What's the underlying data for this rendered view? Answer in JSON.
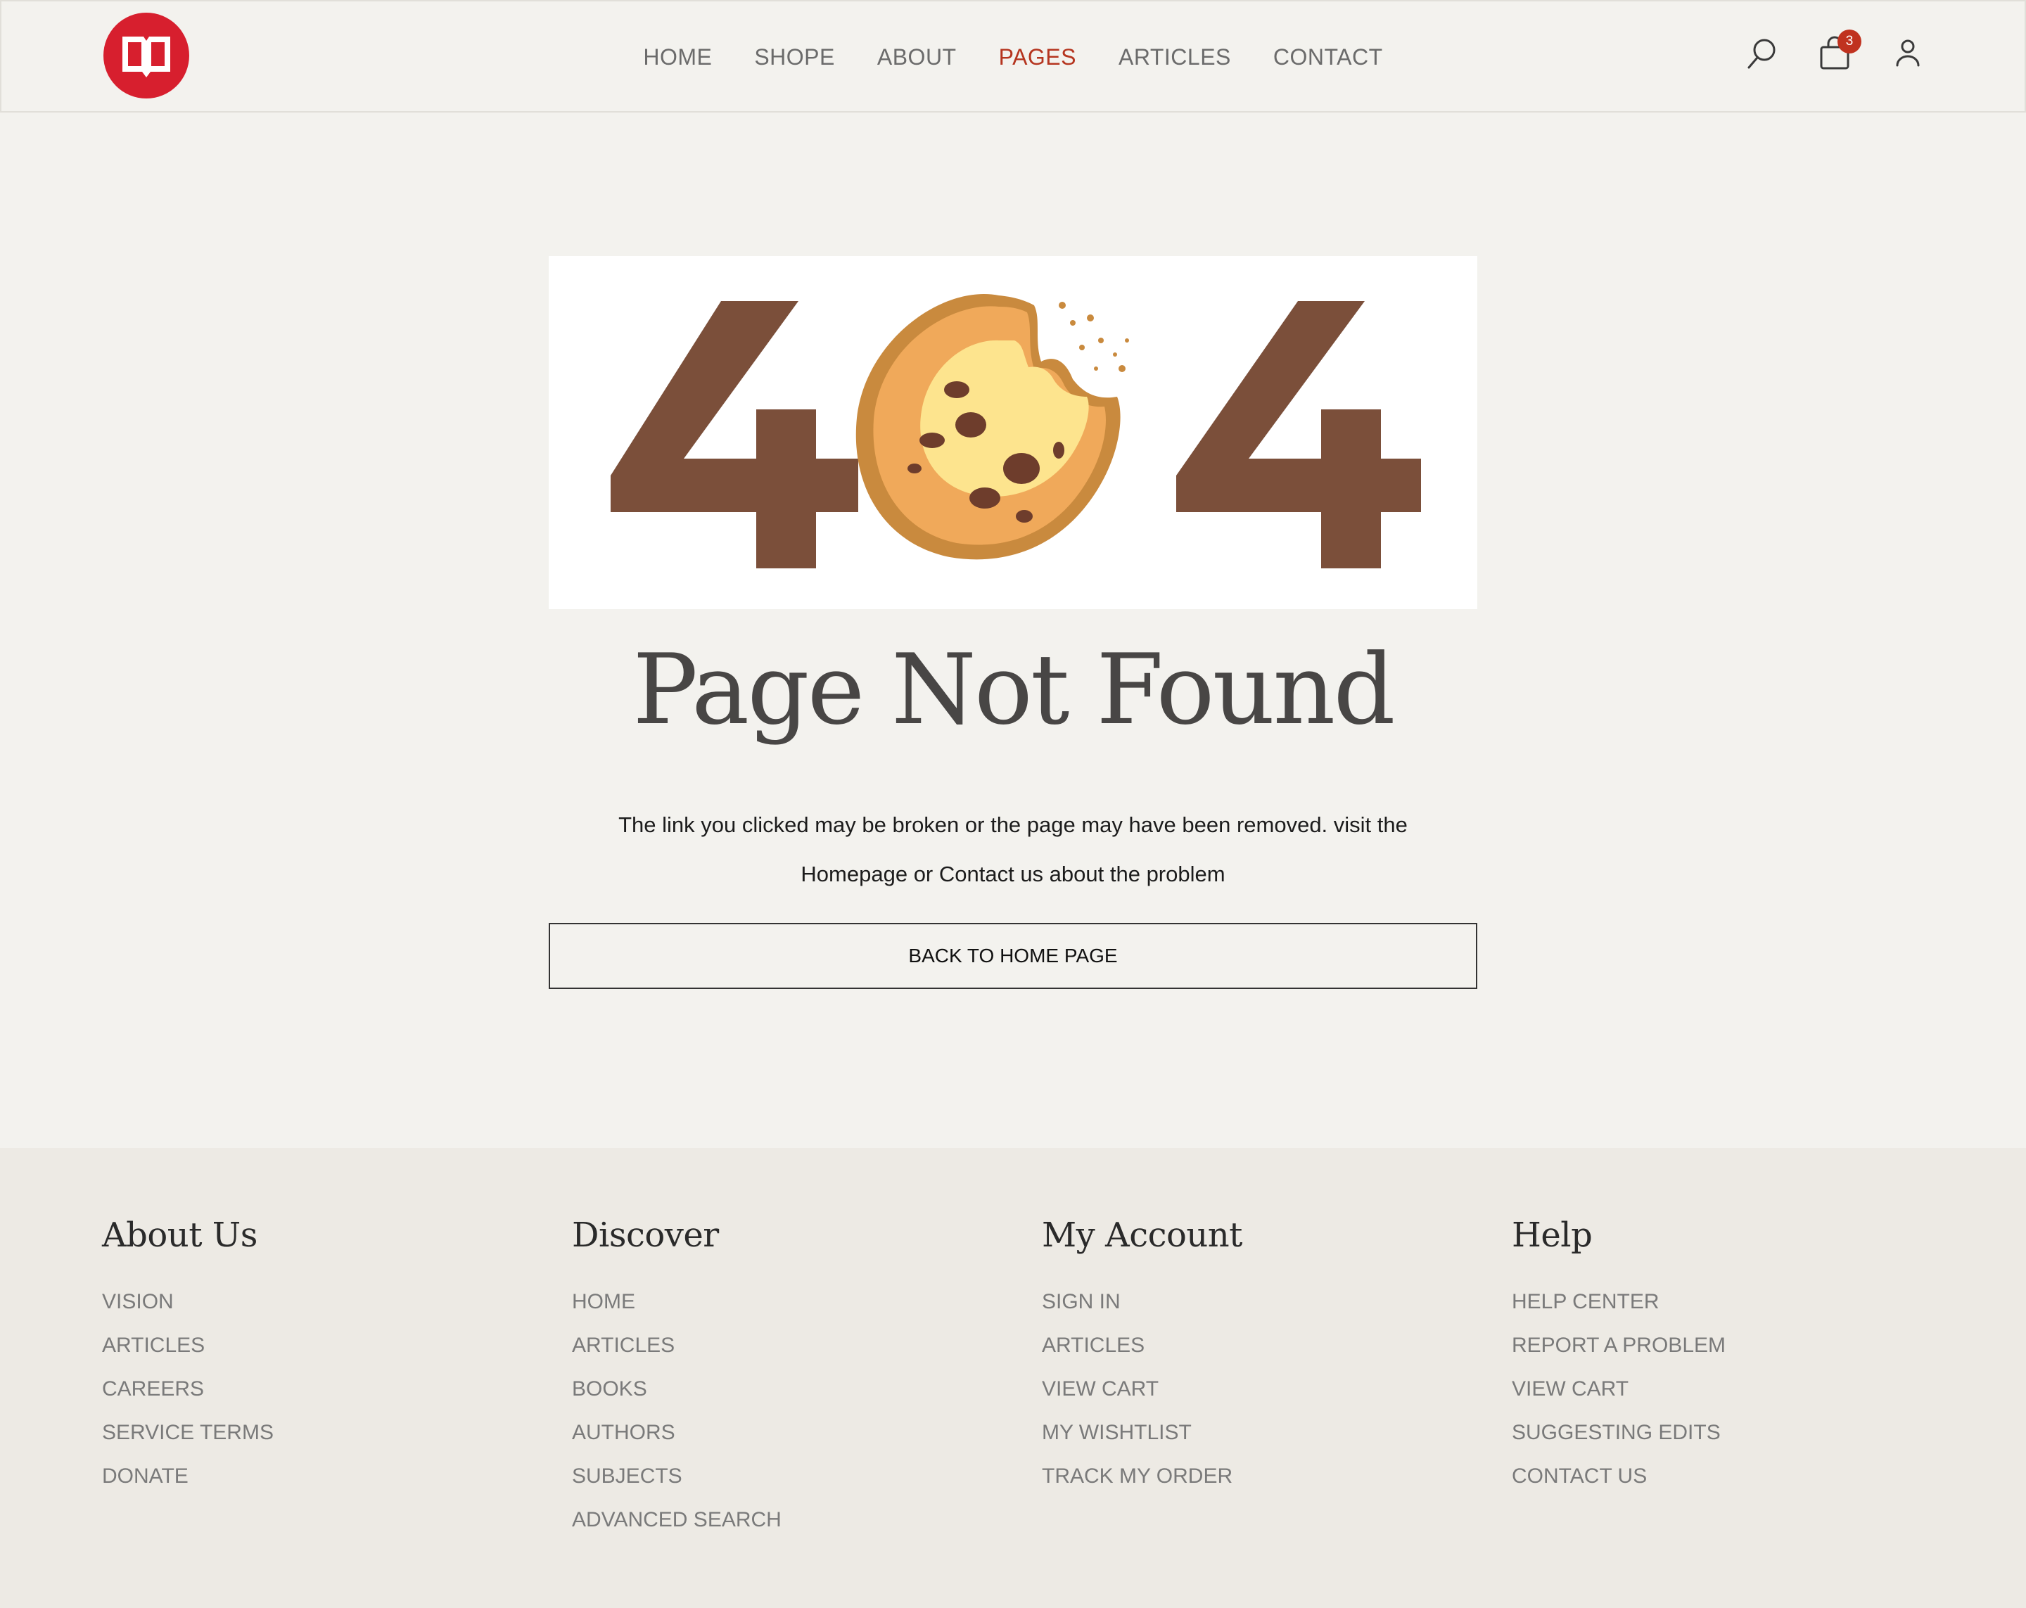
{
  "header": {
    "logo_icon": "open-book-icon",
    "brand_color": "#d71f2e",
    "nav": [
      {
        "label": "HOME",
        "active": false
      },
      {
        "label": "SHOPE",
        "active": false
      },
      {
        "label": "ABOUT",
        "active": false
      },
      {
        "label": "PAGES",
        "active": true
      },
      {
        "label": "ARTICLES",
        "active": false
      },
      {
        "label": "CONTACT",
        "active": false
      }
    ],
    "active_color": "#b5351f",
    "icons": [
      "search-icon",
      "shopping-bag-icon",
      "user-icon"
    ],
    "cart_count": "3"
  },
  "main": {
    "hero_text": "404",
    "hero_digit_left": "4",
    "hero_digit_right": "4",
    "hero_digit_color": "#7b4f3a",
    "title": "Page Not Found",
    "description_line1": "The link you clicked may be broken or the page may have been removed. visit the",
    "description_line2": "Homepage or Contact us about the problem",
    "back_button": "BACK TO HOME PAGE"
  },
  "footer": {
    "columns": [
      {
        "title": "About Us",
        "links": [
          "VISION",
          "ARTICLES",
          "CAREERS",
          "SERVICE TERMS",
          "DONATE"
        ]
      },
      {
        "title": "Discover",
        "links": [
          "HOME",
          "ARTICLES",
          "BOOKS",
          "AUTHORS",
          "SUBJECTS",
          "ADVANCED SEARCH"
        ]
      },
      {
        "title": "My Account",
        "links": [
          "SIGN IN",
          "ARTICLES",
          "VIEW CART",
          "MY WISHTLIST",
          "TRACK MY ORDER"
        ]
      },
      {
        "title": "Help",
        "links": [
          "HELP CENTER",
          "REPORT A PROBLEM",
          "VIEW CART",
          "SUGGESTING EDITS",
          "CONTACT US"
        ]
      }
    ]
  }
}
